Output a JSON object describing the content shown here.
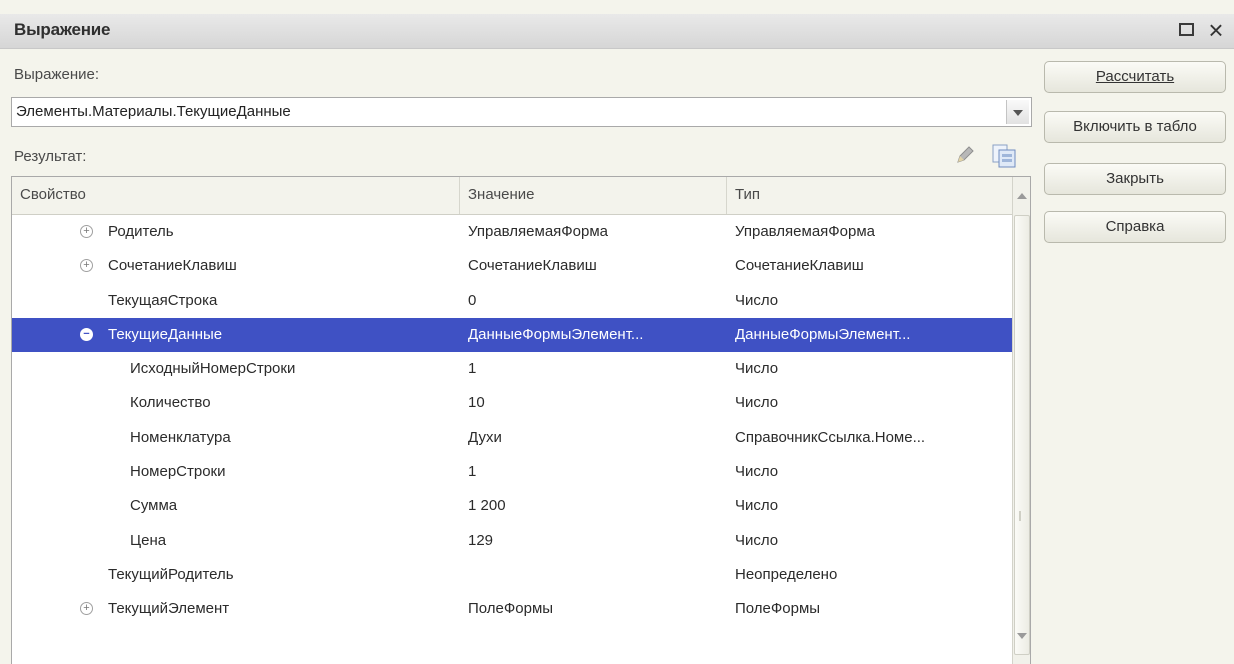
{
  "window": {
    "title": "Выражение"
  },
  "expression": {
    "label": "Выражение:",
    "value": "Элементы.Материалы.ТекущиеДанные"
  },
  "result": {
    "label": "Результат:"
  },
  "buttons": {
    "calculate": "Рассчитать",
    "include_board": "Включить в табло",
    "close": "Закрыть",
    "help": "Справка"
  },
  "grid": {
    "columns": [
      "Свойство",
      "Значение",
      "Тип"
    ],
    "rows": [
      {
        "name": "Родитель",
        "value": "УправляемаяФорма",
        "type": "УправляемаяФорма",
        "level": 1,
        "expand": "+"
      },
      {
        "name": "СочетаниеКлавиш",
        "value": "СочетаниеКлавиш",
        "type": "СочетаниеКлавиш",
        "level": 1,
        "expand": "+"
      },
      {
        "name": "ТекущаяСтрока",
        "value": "0",
        "type": "Число",
        "level": 1,
        "expand": ""
      },
      {
        "name": "ТекущиеДанные",
        "value": "ДанныеФормыЭлемент...",
        "type": "ДанныеФормыЭлемент...",
        "level": 1,
        "expand": "−",
        "selected": true
      },
      {
        "name": "ИсходныйНомерСтроки",
        "value": "1",
        "type": "Число",
        "level": 2,
        "expand": ""
      },
      {
        "name": "Количество",
        "value": "10",
        "type": "Число",
        "level": 2,
        "expand": ""
      },
      {
        "name": "Номенклатура",
        "value": "Духи",
        "type": "СправочникСсылка.Номе...",
        "level": 2,
        "expand": ""
      },
      {
        "name": "НомерСтроки",
        "value": "1",
        "type": "Число",
        "level": 2,
        "expand": ""
      },
      {
        "name": "Сумма",
        "value": "1 200",
        "type": "Число",
        "level": 2,
        "expand": ""
      },
      {
        "name": "Цена",
        "value": "129",
        "type": "Число",
        "level": 2,
        "expand": ""
      },
      {
        "name": "ТекущийРодитель",
        "value": "",
        "type": "Неопределено",
        "level": 1,
        "expand": ""
      },
      {
        "name": "ТекущийЭлемент",
        "value": "ПолеФормы",
        "type": "ПолеФормы",
        "level": 1,
        "expand": "+"
      }
    ]
  },
  "colors": {
    "selection": "#3f51c4",
    "background": "#f4f4ec"
  }
}
